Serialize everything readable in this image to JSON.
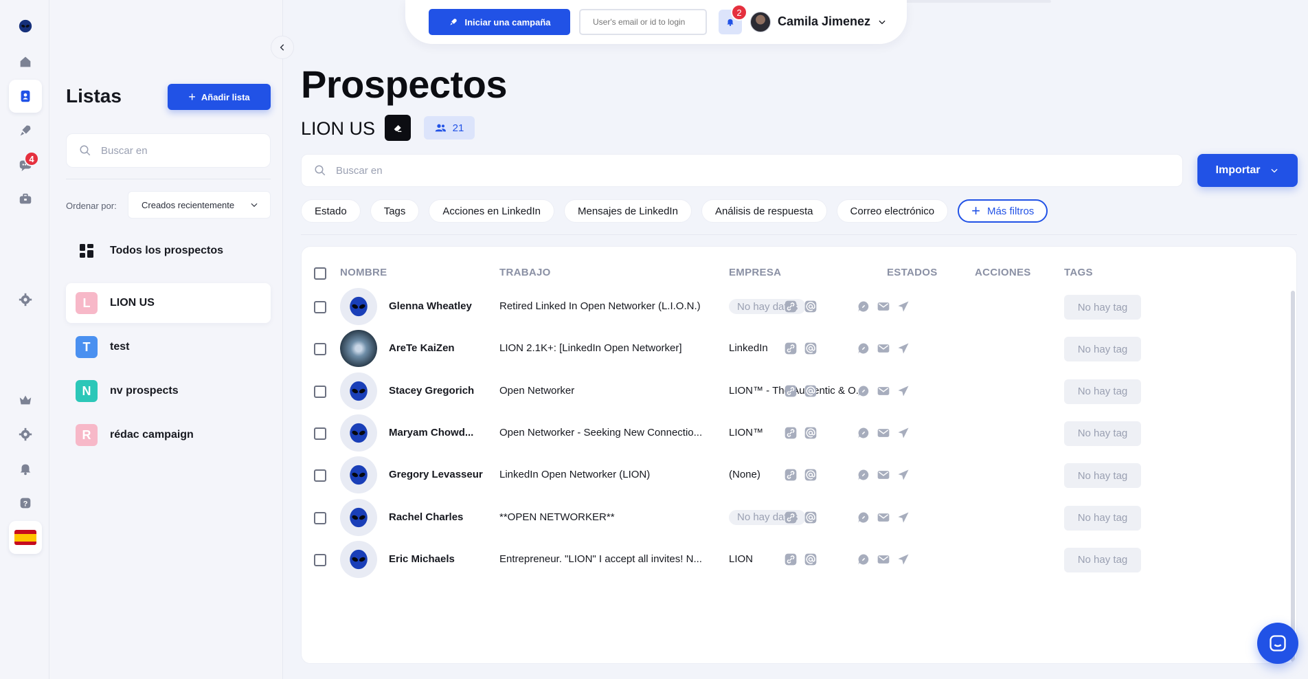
{
  "rail": {
    "notifications_badge": "4"
  },
  "lists_panel": {
    "title": "Listas",
    "add_list_label": "Añadir lista",
    "search_placeholder": "Buscar en",
    "sort_label": "Ordenar por:",
    "sort_value": "Creados recientemente",
    "all_prospects_label": "Todos los prospectos",
    "items": [
      {
        "letter": "L",
        "label": "LION US",
        "color": "#f7b8c8"
      },
      {
        "letter": "T",
        "label": "test",
        "color": "#4a90f0"
      },
      {
        "letter": "N",
        "label": "nv prospects",
        "color": "#2cc7b8"
      },
      {
        "letter": "R",
        "label": "rédac campaign",
        "color": "#f7b8c8"
      }
    ]
  },
  "topbar": {
    "campaign_label": "Iniciar una campaña",
    "login_placeholder": "User's email or id to login",
    "bell_badge": "2",
    "user_name": "Camila Jimenez"
  },
  "main": {
    "title": "Prospectos",
    "list_name": "LION US",
    "count": "21",
    "search_placeholder": "Buscar en",
    "import_label": "Importar",
    "filters": [
      "Estado",
      "Tags",
      "Acciones en LinkedIn",
      "Mensajes de LinkedIn",
      "Análisis de respuesta",
      "Correo electrónico"
    ],
    "more_filters_label": "Más filtros"
  },
  "table": {
    "columns": {
      "name": "NOMBRE",
      "job": "TRABAJO",
      "company": "EMPRESA",
      "states": "ESTADOS",
      "actions": "ACCIONES",
      "tags": "TAGS"
    },
    "rows": [
      {
        "name": "Glenna Wheatley",
        "job": "Retired Linked In Open Networker (L.I.O.N.)",
        "company": "No hay datos",
        "company_missing": true,
        "tag": "No hay tag",
        "avatar": "alien"
      },
      {
        "name": "AreTe KaiZen",
        "job": "LION 2.1K+: [LinkedIn Open Networker]",
        "company": "LinkedIn",
        "company_missing": false,
        "tag": "No hay tag",
        "avatar": "photo"
      },
      {
        "name": "Stacey Gregorich",
        "job": "Open Networker",
        "company": "LION™ - The Authentic & O...",
        "company_missing": false,
        "tag": "No hay tag",
        "avatar": "alien"
      },
      {
        "name": "Maryam Chowd...",
        "job": "Open Networker - Seeking New Connectio...",
        "company": "LION™",
        "company_missing": false,
        "tag": "No hay tag",
        "avatar": "alien"
      },
      {
        "name": "Gregory Levasseur",
        "job": "LinkedIn Open Networker (LION)",
        "company": "(None)",
        "company_missing": false,
        "tag": "No hay tag",
        "avatar": "alien"
      },
      {
        "name": "Rachel Charles",
        "job": "**OPEN NETWORKER**",
        "company": "No hay datos",
        "company_missing": true,
        "tag": "No hay tag",
        "avatar": "alien"
      },
      {
        "name": "Eric Michaels",
        "job": "Entrepreneur. \"LION\" I accept all invites! N...",
        "company": "LION",
        "company_missing": false,
        "tag": "No hay tag",
        "avatar": "alien"
      }
    ]
  },
  "colors": {
    "accent": "#2152e6",
    "badge": "#e5303e",
    "icon_muted": "#9aa0b2"
  }
}
